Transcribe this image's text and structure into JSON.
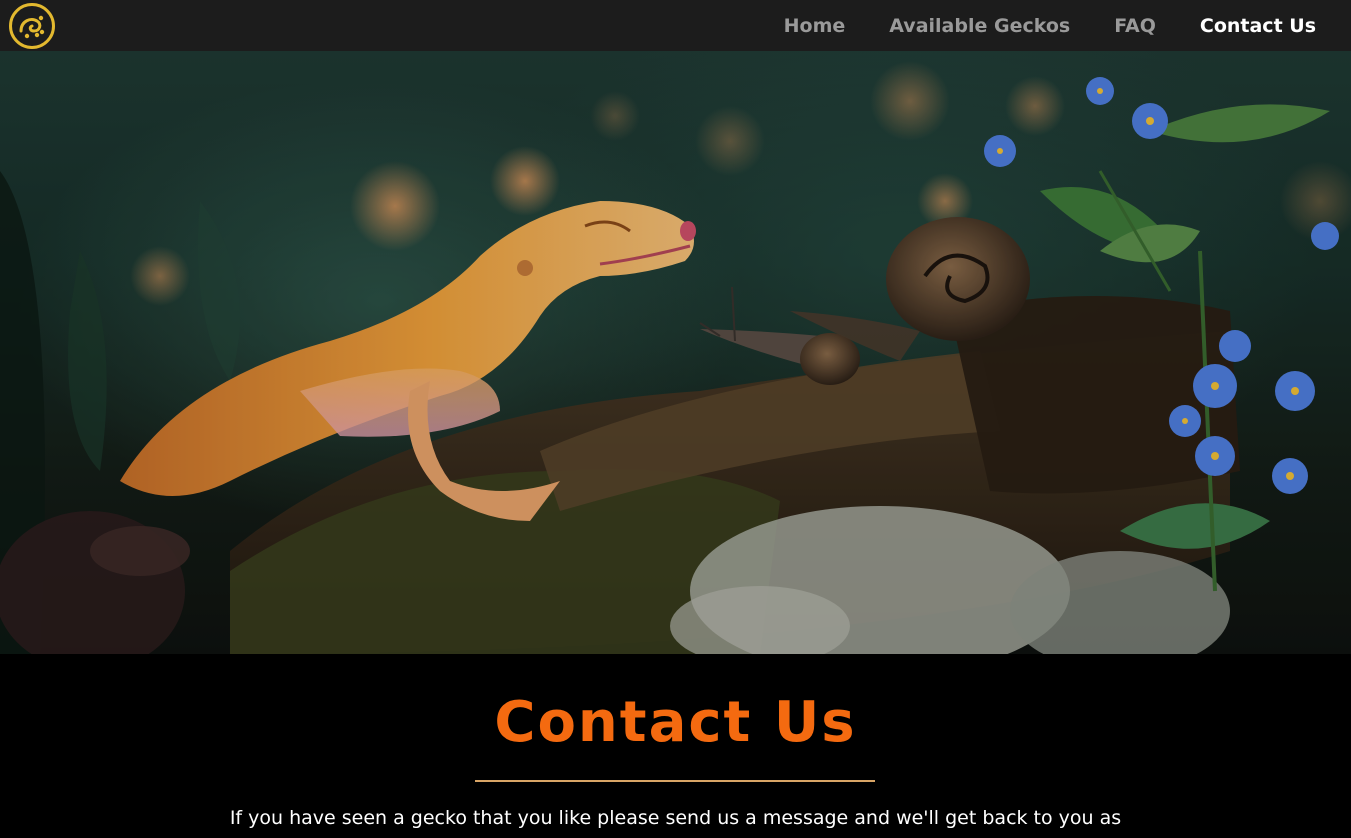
{
  "nav": {
    "logo_icon": "gecko-logo-icon",
    "items": [
      {
        "label": "Home",
        "active": false
      },
      {
        "label": "Available Geckos",
        "active": false
      },
      {
        "label": "FAQ",
        "active": false
      },
      {
        "label": "Contact Us",
        "active": true
      }
    ]
  },
  "hero": {
    "image": "leopard-gecko-with-snail-photo"
  },
  "contact": {
    "title": "Contact Us",
    "intro": "If you have seen a gecko that you like please send us a message and we'll get back to you as"
  },
  "colors": {
    "nav_bg": "#1c1c1c",
    "accent_gold": "#e3b92f",
    "title_orange": "#f46a10",
    "divider": "#d9a566",
    "page_bg": "#000000"
  }
}
